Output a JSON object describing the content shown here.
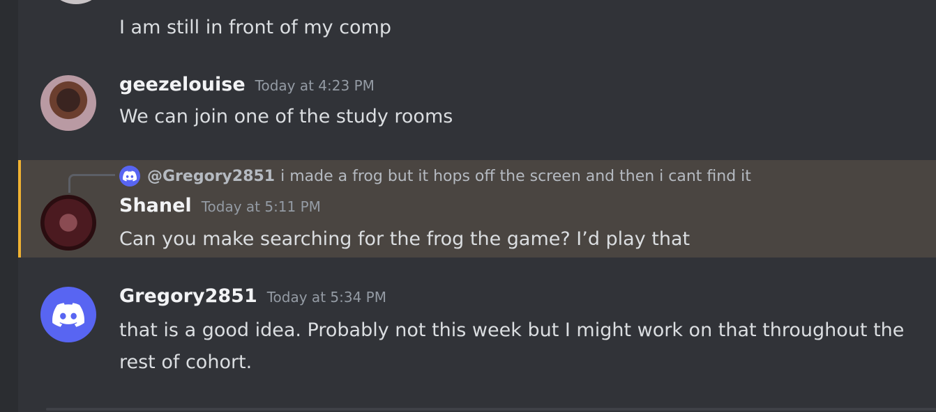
{
  "previous_message": {
    "text": "I am still in front of my comp"
  },
  "messages": [
    {
      "username": "geezelouise",
      "timestamp": "Today at 4:23 PM",
      "text": "We can join  one of the study rooms"
    },
    {
      "reply_to": {
        "author": "@Gregory2851",
        "text": "i made a frog but it hops off the screen and then i cant find it"
      },
      "username": "Shanel",
      "timestamp": "Today at 5:11 PM",
      "text": "Can you make searching for the frog the game? I’d play that"
    },
    {
      "username": "Gregory2851",
      "timestamp": "Today at 5:34 PM",
      "text": "that is a good idea. Probably not this week but I might work on that throughout the rest of cohort."
    }
  ],
  "colors": {
    "background": "#313338",
    "highlight": "#4a4541",
    "highlight_border": "#f0b232",
    "discord_blurple": "#5865f2"
  },
  "icons": {
    "discord_avatar": "discord-logo-icon"
  }
}
